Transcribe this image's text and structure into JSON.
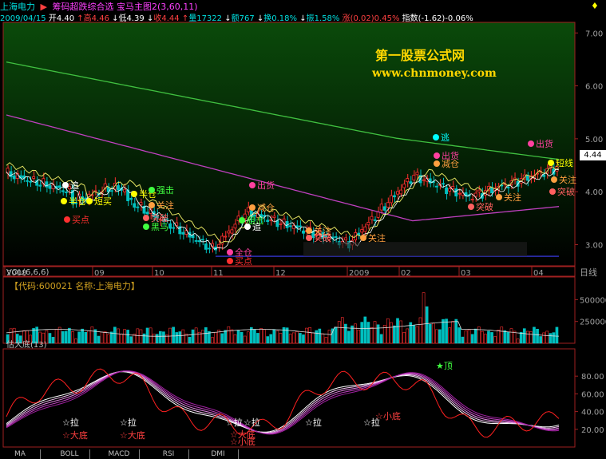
{
  "header": {
    "stock_name": "上海电力",
    "formula": "筹码超跌综合选",
    "main_chart": "宝马主图2(3,60,11)",
    "date": "2009/04/15",
    "open_label": "开",
    "open": "4.40",
    "high_label": "高",
    "high": "4.46",
    "low_label": "低",
    "low": "4.39",
    "close_label": "收",
    "close": "4.44",
    "volume_label": "量",
    "volume": "17322",
    "amount_label": "额",
    "amount": "767",
    "turnover_label": "换",
    "turnover": "0.18%",
    "amplitude_label": "振",
    "amplitude": "1.58%",
    "change_label": "涨",
    "change": "(0.02)",
    "change_pct": "0.45%",
    "index_label": "指数",
    "index_value": "(-1.62)-0.06%"
  },
  "watermark": {
    "line1": "第一股票公式网",
    "line2": "www.chnmoney.com"
  },
  "price_tag": "4.44",
  "chart_data": [
    {
      "type": "line",
      "name": "price-panel",
      "ylim": [
        2.6,
        7.2
      ],
      "yticks": [
        "7.00",
        "6.00",
        "5.00",
        "4.00",
        "3.00"
      ],
      "ytick_values": [
        7.0,
        6.0,
        5.0,
        4.0,
        3.0
      ],
      "xticks": [
        "2008",
        "09",
        "10",
        "11",
        "12",
        "2009",
        "02",
        "03",
        "04"
      ],
      "x_axis_unit": "日线",
      "signals": [
        {
          "text": "追",
          "color": "#ffffff"
        },
        {
          "text": "半仓",
          "color": "#ffff00"
        },
        {
          "text": "短买",
          "color": "#ffff00"
        },
        {
          "text": "买点",
          "color": "#ff3030"
        },
        {
          "text": "半仓",
          "color": "#ffff00"
        },
        {
          "text": "强击",
          "color": "#40ff40"
        },
        {
          "text": "关注",
          "color": "#ffa040"
        },
        {
          "text": "突破",
          "color": "#ff6060"
        },
        {
          "text": "黑马",
          "color": "#40ff40"
        },
        {
          "text": "出货",
          "color": "#ff40a0"
        },
        {
          "text": "减仓",
          "color": "#ffa040"
        },
        {
          "text": "狙击",
          "color": "#40ff40"
        },
        {
          "text": "追",
          "color": "#ffffff"
        },
        {
          "text": "全仓",
          "color": "#ff40a0"
        },
        {
          "text": "买点",
          "color": "#ff3030"
        },
        {
          "text": "关注",
          "color": "#ffa040"
        },
        {
          "text": "突破",
          "color": "#ff6060"
        },
        {
          "text": "关注",
          "color": "#ffa040"
        },
        {
          "text": "逃",
          "color": "#00ffff"
        },
        {
          "text": "出货",
          "color": "#ff40a0"
        },
        {
          "text": "减仓",
          "color": "#ffa040"
        },
        {
          "text": "突破",
          "color": "#ff6060"
        },
        {
          "text": "关注",
          "color": "#ffa040"
        },
        {
          "text": "出货",
          "color": "#ff40a0"
        },
        {
          "text": "短线",
          "color": "#ffff00"
        },
        {
          "text": "关注",
          "color": "#ffa040"
        },
        {
          "text": "突破",
          "color": "#ff6060"
        }
      ]
    },
    {
      "type": "bar",
      "name": "volume-panel",
      "title": "VOL(6,6,6)",
      "code_label": "【代码:600021 名称:上海电力】",
      "ylim": [
        0,
        650000
      ],
      "yticks": [
        "500000",
        "250000"
      ],
      "ytick_values": [
        500000,
        250000
      ]
    },
    {
      "type": "line",
      "name": "indicator-panel",
      "title": "估大底(13)",
      "ylim": [
        0,
        100
      ],
      "yticks": [
        "80.00",
        "60.00",
        "40.00",
        "20.00"
      ],
      "ytick_values": [
        80,
        60,
        40,
        20
      ],
      "signals": [
        {
          "text": "☆拉",
          "color": "#ffffff"
        },
        {
          "text": "☆大底",
          "color": "#ff4040"
        },
        {
          "text": "☆拉",
          "color": "#ffffff"
        },
        {
          "text": "☆大底",
          "color": "#ff4040"
        },
        {
          "text": "☆拉",
          "color": "#ffffff"
        },
        {
          "text": "☆拉",
          "color": "#ffffff"
        },
        {
          "text": "☆大底",
          "color": "#ff4040"
        },
        {
          "text": "☆小底",
          "color": "#ff4040"
        },
        {
          "text": "☆拉",
          "color": "#ffffff"
        },
        {
          "text": "☆拉",
          "color": "#ffffff"
        },
        {
          "text": "☆小底",
          "color": "#ff4040"
        },
        {
          "text": "★顶",
          "color": "#40ff40"
        }
      ]
    }
  ],
  "tabs": [
    "MA",
    "BOLL",
    "MACD",
    "RSI",
    "DMI"
  ]
}
